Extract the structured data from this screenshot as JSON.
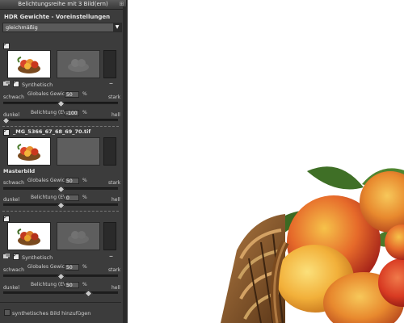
{
  "panel": {
    "title": "Belichtungsreihe mit 3 Bild(ern)",
    "pin_glyph": "⊞",
    "hdr_heading": "HDR Gewichte - Voreinstellungen",
    "preset": {
      "value": "gleichmäßig",
      "arrow": "▼"
    }
  },
  "images": [
    {
      "synthetic_label": "Synthetisch",
      "collapse_glyph": "–",
      "weight": {
        "left": "schwach",
        "label": "Globales Gewicht",
        "value": "50",
        "unit": "%",
        "right": "stark",
        "level": 0.5
      },
      "exposure": {
        "left": "dunkel",
        "label": "Belichtung (EV)",
        "value": "-100",
        "unit": "%",
        "right": "hell",
        "level": 0.0
      }
    },
    {
      "filename": "_MG_5366_67_68_69_70.tif",
      "master_label": "Masterbild",
      "weight": {
        "left": "schwach",
        "label": "Globales Gewicht",
        "value": "50",
        "unit": "%",
        "right": "stark",
        "level": 0.5
      },
      "exposure": {
        "left": "dunkel",
        "label": "Belichtung (EV)",
        "value": "0",
        "unit": "%",
        "right": "hell",
        "level": 0.5
      }
    },
    {
      "synthetic_label": "Synthetisch",
      "collapse_glyph": "–",
      "weight": {
        "left": "schwach",
        "label": "Globales Gewicht",
        "value": "50",
        "unit": "%",
        "right": "stark",
        "level": 0.5
      },
      "exposure": {
        "left": "dunkel",
        "label": "Belichtung (EV)",
        "value": "50",
        "unit": "%",
        "right": "hell",
        "level": 0.75
      }
    }
  ],
  "footer": {
    "add_synthetic_label": "synthetisches Bild hinzufügen"
  },
  "colors": {
    "panel_bg": "#3c3c3c",
    "canvas_bg": "#ffffff",
    "fruit_red": "#d8452a",
    "fruit_yellow": "#f2b43a",
    "basket": "#8a5a2b",
    "leaf": "#4a7a2a"
  }
}
